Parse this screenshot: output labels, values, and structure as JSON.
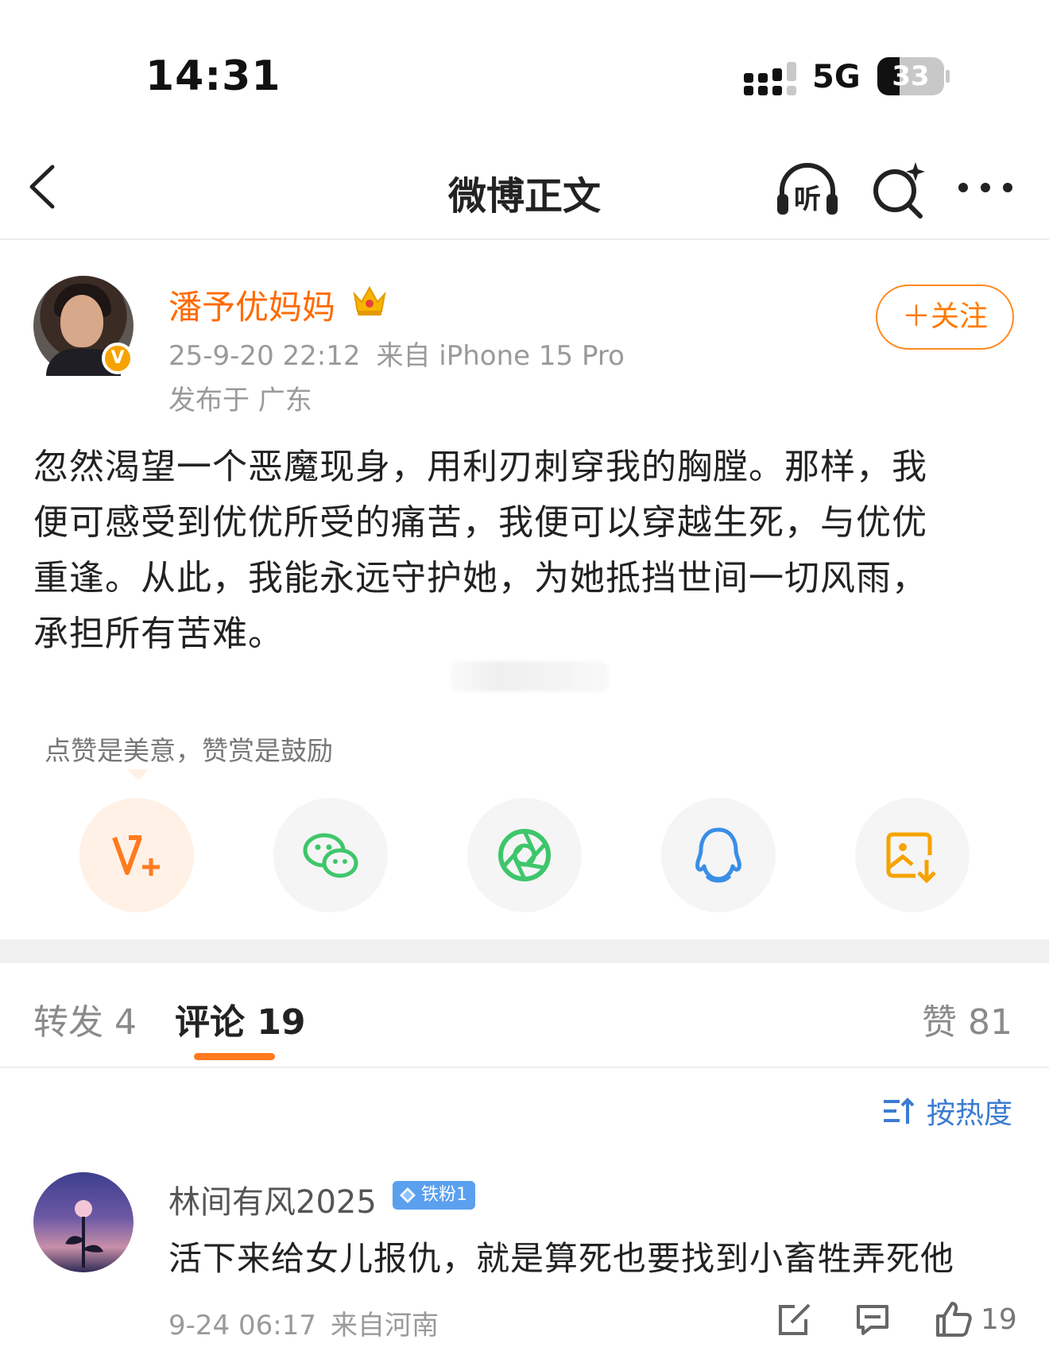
{
  "status_bar": {
    "time": "14:31",
    "network": "5G",
    "battery_text": "33",
    "battery_level": 0.33
  },
  "nav": {
    "title": "微博正文",
    "listen_label": "听"
  },
  "post": {
    "author_name": "潘予优妈妈",
    "date": "25-9-20 22:12",
    "source": "来自 iPhone 15 Pro",
    "location": "发布于 广东",
    "follow_label": "＋关注",
    "verified_mark": "V",
    "text_lines": [
      "忽然渴望一个恶魔现身，用利刃刺穿我的胸膛。那样，我",
      "便可感受到优优所受的痛苦，我便可以穿越生死，与优优",
      "重逢。从此，我能永远守护她，为她抵挡世间一切风雨，",
      "承担所有苦难。"
    ]
  },
  "reward": {
    "tip": "点赞是美意，赞赏是鼓励"
  },
  "share_icons": [
    "reward-v-plus-icon",
    "wechat-icon",
    "moments-icon",
    "qq-icon",
    "save-image-icon"
  ],
  "colors": {
    "accent": "#ff7a00",
    "link": "#3b7bd1",
    "wechat": "#3ec66b",
    "qq": "#3a8ee6",
    "save": "#f5a300"
  },
  "tabs": {
    "reposts": "转发 4",
    "comments": "评论 19",
    "likes": "赞 81"
  },
  "sort": {
    "label": "按热度"
  },
  "comment": {
    "username": "林间有风2025",
    "badge": "铁粉1",
    "text": "活下来给女儿报仇，就是算死也要找到小畜牲弄死他",
    "date": "9-24 06:17",
    "location": "来自河南",
    "like_count": "19"
  }
}
